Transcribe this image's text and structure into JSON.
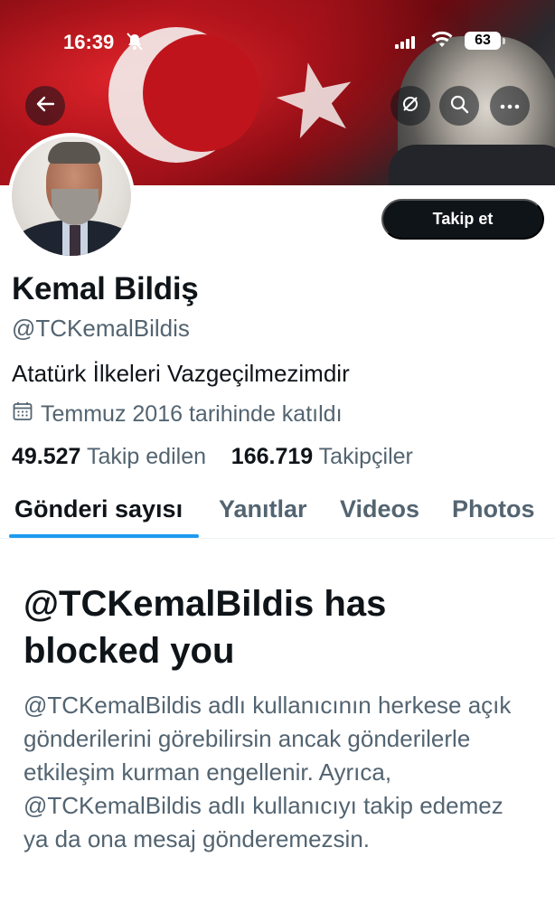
{
  "status_bar": {
    "time": "16:39",
    "battery": "63"
  },
  "header": {
    "back_icon": "arrow-left-icon",
    "sync_icon": "sync-off-icon",
    "search_icon": "search-icon",
    "more_icon": "more-horizontal-icon"
  },
  "profile": {
    "name": "Kemal Bildiş",
    "handle": "@TCKemalBildis",
    "bio": "Atatürk İlkeleri Vazgeçilmezimdir",
    "joined": "Temmuz 2016 tarihinde katıldı",
    "follow_label": "Takip et",
    "following_count": "49.527",
    "following_label": "Takip edilen",
    "followers_count": "166.719",
    "followers_label": "Takipçiler"
  },
  "tabs": [
    {
      "label": "Gönderi sayısı",
      "active": true
    },
    {
      "label": "Yanıtlar",
      "active": false
    },
    {
      "label": "Videos",
      "active": false
    },
    {
      "label": "Photos",
      "active": false
    }
  ],
  "blocked": {
    "title": "@TCKemalBildis has blocked you",
    "body": "@TCKemalBildis adlı kullanıcının herkese açık gönderilerini görebilirsin ancak gönderilerle etkileşim kurman engellenir. Ayrıca, @TCKemalBildis adlı kullanıcıyı takip edemez ya da ona mesaj gönderemezsin."
  },
  "colors": {
    "accent": "#1d9bf0",
    "text_primary": "#0f1419",
    "text_secondary": "#536471"
  }
}
